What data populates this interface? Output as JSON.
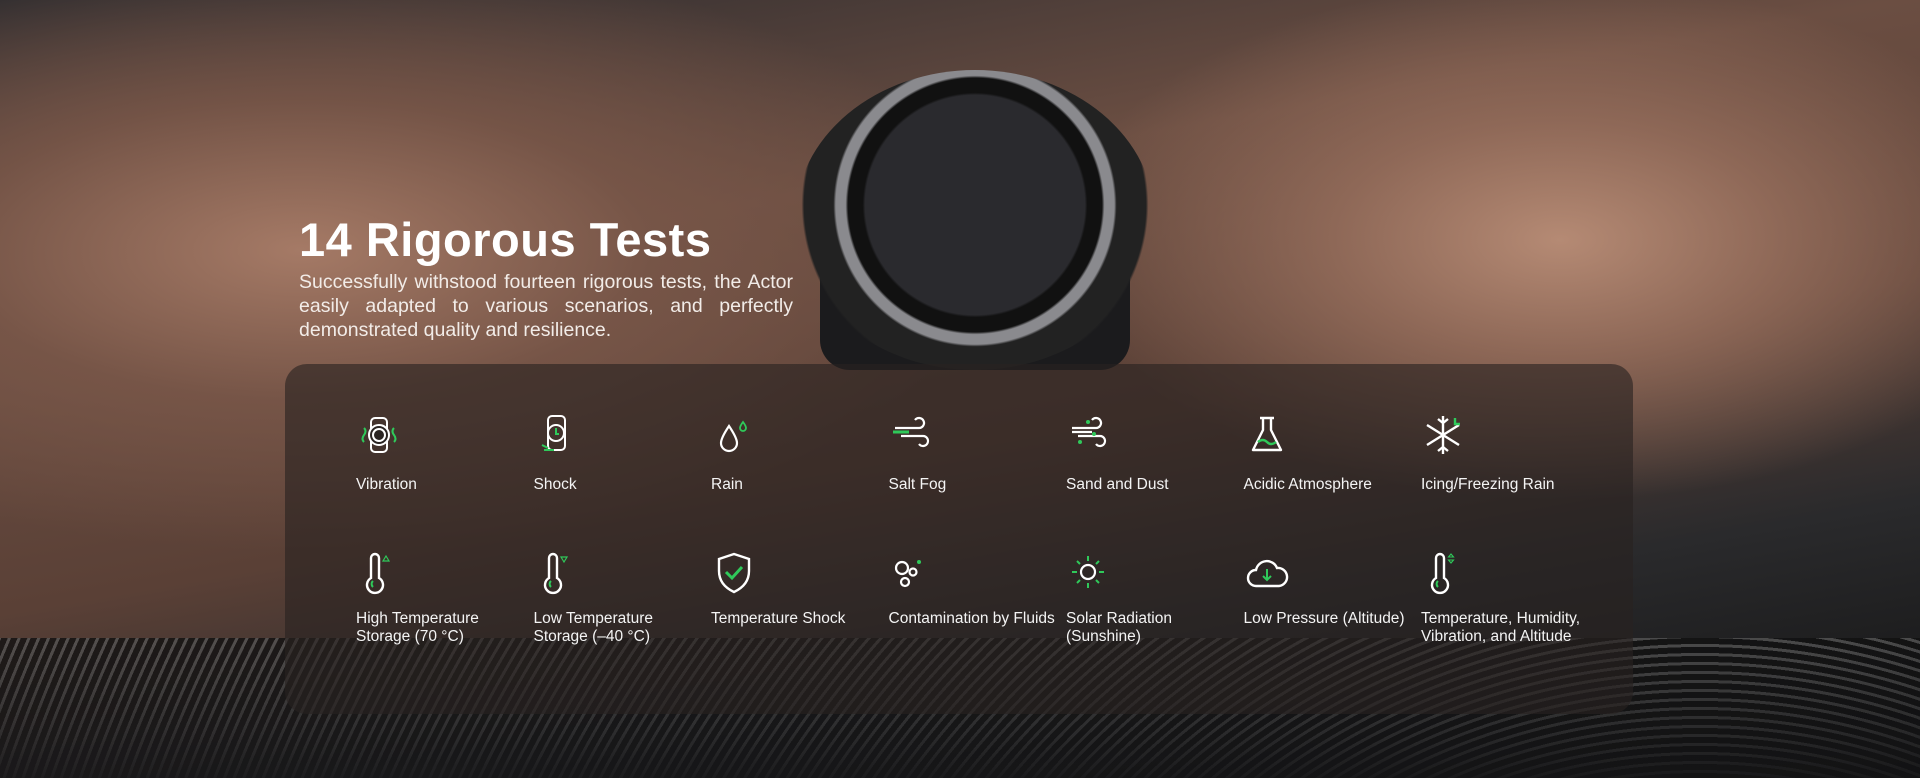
{
  "hero": {
    "title": "14 Rigorous Tests",
    "description": "Successfully withstood fourteen rigorous tests, the Actor easily adapted to various scenarios, and perfectly demonstrated quality and resilience."
  },
  "accent_color": "#2fc95a",
  "tests": [
    {
      "label": "Vibration",
      "icon": "watch-vibration-icon"
    },
    {
      "label": "Shock",
      "icon": "watch-shock-icon"
    },
    {
      "label": "Rain",
      "icon": "raindrop-icon"
    },
    {
      "label": "Salt Fog",
      "icon": "wind-icon"
    },
    {
      "label": "Sand and Dust",
      "icon": "wind-dust-icon"
    },
    {
      "label": "Acidic Atmosphere",
      "icon": "flask-icon"
    },
    {
      "label": "Icing/Freezing Rain",
      "icon": "snowflake-icon"
    },
    {
      "label": "High Temperature Storage (70 °C)",
      "icon": "thermometer-up-icon"
    },
    {
      "label": "Low Temperature Storage (–40 °C)",
      "icon": "thermometer-down-icon"
    },
    {
      "label": "Temperature Shock",
      "icon": "shield-check-icon"
    },
    {
      "label": "Contamination by Fluids",
      "icon": "bubbles-icon"
    },
    {
      "label": "Solar Radiation (Sunshine)",
      "icon": "sun-icon"
    },
    {
      "label": "Low Pressure (Altitude)",
      "icon": "cloud-down-icon"
    },
    {
      "label": "Temperature, Humidity, Vibration, and Altitude",
      "icon": "thermometer-updown-icon"
    }
  ]
}
